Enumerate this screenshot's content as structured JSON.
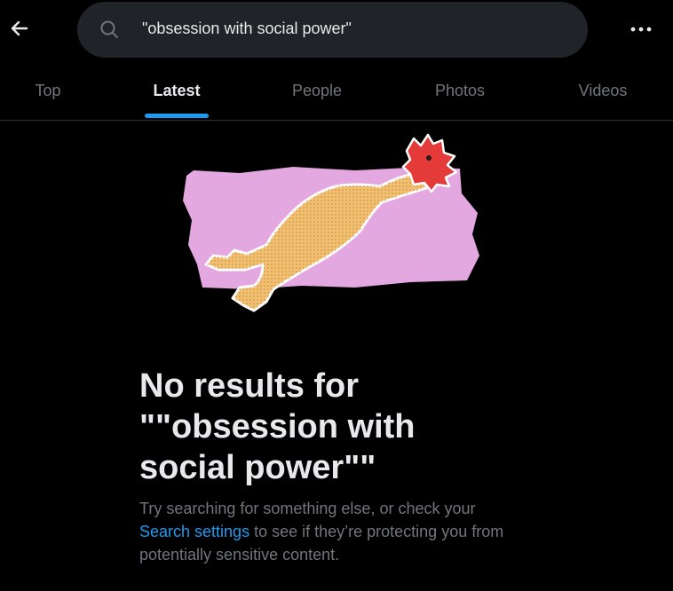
{
  "header": {
    "back_icon": "arrow-left-icon",
    "search": {
      "icon": "search-icon",
      "value": "\"obsession with social power\""
    },
    "more_icon": "more-horizontal-icon"
  },
  "tabs": [
    {
      "label": "Top",
      "active": false
    },
    {
      "label": "Latest",
      "active": true
    },
    {
      "label": "People",
      "active": false
    },
    {
      "label": "Photos",
      "active": false
    },
    {
      "label": "Videos",
      "active": false
    }
  ],
  "empty_state": {
    "illustration": "rubber-chicken-illustration",
    "title": "No results for \"\"obsession with social power\"\"",
    "hint_before": "Try searching for something else, or check your ",
    "hint_link": "Search settings",
    "hint_after": " to see if they’re protecting you from potentially sensitive content."
  },
  "colors": {
    "background": "#000000",
    "search_box": "#202327",
    "accent": "#1d9bf0",
    "text_primary": "#e7e9ea",
    "text_secondary": "#71767b",
    "illustration_backdrop": "#e4a8e0",
    "chicken_body": "#f0c070",
    "chicken_comb": "#e43a3a"
  }
}
